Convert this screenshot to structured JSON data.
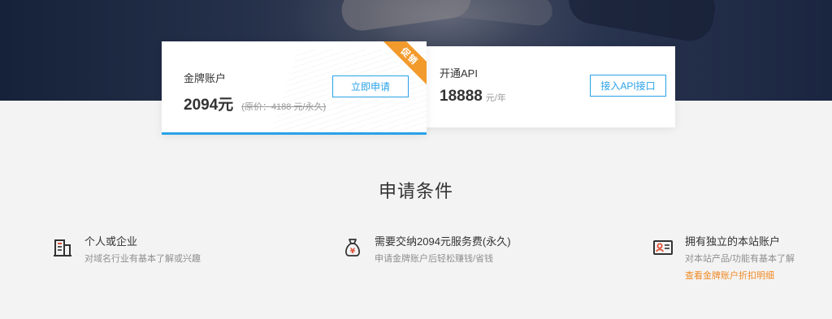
{
  "cards": {
    "gold": {
      "title": "金牌账户",
      "price": "2094元",
      "original_price": "(原价：4188 元/永久)",
      "button": "立即申请",
      "ribbon": "促销"
    },
    "api": {
      "title": "开通API",
      "price": "18888",
      "unit": "元/年",
      "button": "接入API接口"
    }
  },
  "section": {
    "title": "申请条件"
  },
  "conditions": [
    {
      "icon": "building-icon",
      "title": "个人或企业",
      "desc": "对域名行业有基本了解或兴趣"
    },
    {
      "icon": "money-bag-icon",
      "title": "需要交纳2094元服务费(永久)",
      "desc": "申请金牌账户后轻松赚钱/省钱"
    },
    {
      "icon": "id-card-icon",
      "title": "拥有独立的本站账户",
      "desc": "对本站产品/功能有基本了解",
      "link": "查看金牌账户折扣明细"
    }
  ],
  "colors": {
    "accent": "#2aa1e8",
    "ribbon": "#f39a2c",
    "link": "#f08a24",
    "hero": "#1f2a42"
  }
}
